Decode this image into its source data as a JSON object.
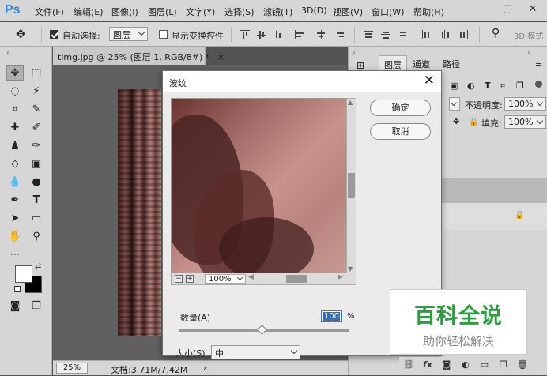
{
  "app": {
    "logo": "Ps"
  },
  "menu": [
    "文件(F)",
    "编辑(E)",
    "图像(I)",
    "图层(L)",
    "文字(Y)",
    "选择(S)",
    "滤镜(T)",
    "3D(D)",
    "视图(V)",
    "窗口(W)",
    "帮助(H)"
  ],
  "window_controls": {
    "minimize": "—",
    "maximize": "▢",
    "close": "✕"
  },
  "options": {
    "auto_select_label": "自动选择:",
    "auto_select_value": "图层",
    "show_transform_label": "显示变换控件",
    "mode_3d": "3D 模式"
  },
  "document": {
    "tab_title": "timg.jpg @ 25% (图层 1, RGB/8#) *",
    "tab_close": "×"
  },
  "statusbar": {
    "zoom": "25%",
    "doc_info": "文档:3.71M/7.42M",
    "arrow": "›"
  },
  "panel": {
    "tabs": [
      "图层",
      "通道",
      "路径"
    ],
    "opacity_label": "不透明度:",
    "opacity_value": "100%",
    "fill_label": "填充:",
    "fill_value": "100%"
  },
  "dialog": {
    "title": "波纹",
    "close": "✕",
    "ok": "确定",
    "cancel": "取消",
    "preview_zoom": "100%",
    "amount_label": "数量(A)",
    "amount_value": "100",
    "amount_unit": "%",
    "amount_fraction": 0.49,
    "size_label": "大小(S)",
    "size_value": "中"
  },
  "watermark": {
    "line1": "百科全说",
    "line2": "助你轻松解决"
  }
}
